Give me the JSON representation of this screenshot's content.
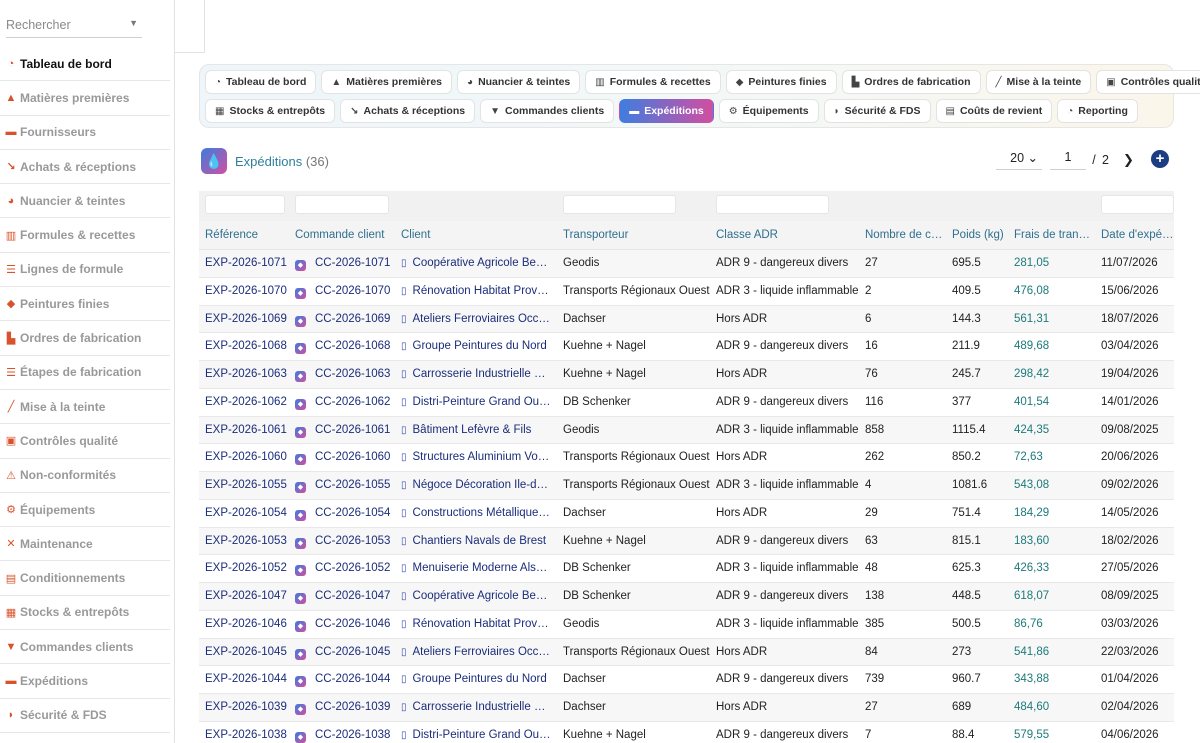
{
  "search": {
    "placeholder": "Rechercher"
  },
  "sidebar": {
    "items": [
      {
        "label": "Tableau de bord",
        "icon": "dashboard-icon",
        "glyph": "◔",
        "active": true
      },
      {
        "label": "Matières premières",
        "icon": "flask-icon",
        "glyph": "▲"
      },
      {
        "label": "Fournisseurs",
        "icon": "truck-icon",
        "glyph": "▬"
      },
      {
        "label": "Achats & réceptions",
        "icon": "dolly-icon",
        "glyph": "↘"
      },
      {
        "label": "Nuancier & teintes",
        "icon": "palette-icon",
        "glyph": "◕"
      },
      {
        "label": "Formules & recettes",
        "icon": "mortar-icon",
        "glyph": "▥"
      },
      {
        "label": "Lignes de formule",
        "icon": "list-icon",
        "glyph": "☰"
      },
      {
        "label": "Peintures finies",
        "icon": "paint-bucket-icon",
        "glyph": "◆"
      },
      {
        "label": "Ordres de fabrication",
        "icon": "industry-icon",
        "glyph": "▙"
      },
      {
        "label": "Étapes de fabrication",
        "icon": "steps-icon",
        "glyph": "☰"
      },
      {
        "label": "Mise à la teinte",
        "icon": "eyedropper-icon",
        "glyph": "╱"
      },
      {
        "label": "Contrôles qualité",
        "icon": "clipboard-check-icon",
        "glyph": "▣"
      },
      {
        "label": "Non-conformités",
        "icon": "warning-icon",
        "glyph": "⚠"
      },
      {
        "label": "Équipements",
        "icon": "cogs-icon",
        "glyph": "⚙"
      },
      {
        "label": "Maintenance",
        "icon": "tools-icon",
        "glyph": "✕"
      },
      {
        "label": "Conditionnements",
        "icon": "box-icon",
        "glyph": "▤"
      },
      {
        "label": "Stocks & entrepôts",
        "icon": "warehouse-icon",
        "glyph": "▦"
      },
      {
        "label": "Commandes clients",
        "icon": "cart-icon",
        "glyph": "▼"
      },
      {
        "label": "Expéditions",
        "icon": "shipping-icon",
        "glyph": "▬"
      },
      {
        "label": "Sécurité & FDS",
        "icon": "shield-icon",
        "glyph": "◗"
      },
      {
        "label": "",
        "icon": "more-icon",
        "glyph": ""
      }
    ]
  },
  "nav": {
    "row1": [
      {
        "label": "Tableau de bord",
        "icon": "dashboard-icon",
        "glyph": "◔"
      },
      {
        "label": "Matières premières",
        "icon": "flask-icon",
        "glyph": "▲"
      },
      {
        "label": "Nuancier & teintes",
        "icon": "palette-icon",
        "glyph": "◕"
      },
      {
        "label": "Formules & recettes",
        "icon": "mortar-icon",
        "glyph": "▥"
      },
      {
        "label": "Peintures finies",
        "icon": "paint-bucket-icon",
        "glyph": "◆"
      },
      {
        "label": "Ordres de fabrication",
        "icon": "industry-icon",
        "glyph": "▙"
      },
      {
        "label": "Mise à la teinte",
        "icon": "eyedropper-icon",
        "glyph": "╱"
      },
      {
        "label": "Contrôles qualité",
        "icon": "clipboard-check-icon",
        "glyph": "▣"
      }
    ],
    "row2": [
      {
        "label": "Stocks & entrepôts",
        "icon": "warehouse-icon",
        "glyph": "▦"
      },
      {
        "label": "Achats & réceptions",
        "icon": "dolly-icon",
        "glyph": "↘"
      },
      {
        "label": "Commandes clients",
        "icon": "cart-icon",
        "glyph": "▼"
      },
      {
        "label": "Expéditions",
        "icon": "shipping-icon",
        "glyph": "▬",
        "active": true
      },
      {
        "label": "Équipements",
        "icon": "cogs-icon",
        "glyph": "⚙"
      },
      {
        "label": "Sécurité & FDS",
        "icon": "shield-icon",
        "glyph": "◗"
      },
      {
        "label": "Coûts de revient",
        "icon": "money-icon",
        "glyph": "▤"
      },
      {
        "label": "Reporting",
        "icon": "pie-chart-icon",
        "glyph": "◔"
      }
    ]
  },
  "header": {
    "title": "Expéditions",
    "count": "(36)",
    "logo_glyph": "💧",
    "per_page": "20 ⌄",
    "page_current": "1",
    "page_sep": "/",
    "page_total": "2",
    "next_glyph": "❯",
    "add_glyph": "+"
  },
  "table": {
    "columns": [
      "Référence",
      "Commande client",
      "Client",
      "Transporteur",
      "Classe ADR",
      "Nombre de c…",
      "Poids (kg)",
      "Frais de tran…",
      "Date d'expé…"
    ],
    "rows": [
      [
        "EXP-2026-1071",
        "CC-2026-1071",
        "Coopérative Agricole Be…",
        "Geodis",
        "ADR 9 - dangereux divers",
        "27",
        "695.5",
        "281,05",
        "11/07/2026"
      ],
      [
        "EXP-2026-1070",
        "CC-2026-1070",
        "Rénovation Habitat Prov…",
        "Transports Régionaux Ouest",
        "ADR 3 - liquide inflammable",
        "2",
        "409.5",
        "476,08",
        "15/06/2026"
      ],
      [
        "EXP-2026-1069",
        "CC-2026-1069",
        "Ateliers Ferroviaires Occ…",
        "Dachser",
        "Hors ADR",
        "6",
        "144.3",
        "561,31",
        "18/07/2026"
      ],
      [
        "EXP-2026-1068",
        "CC-2026-1068",
        "Groupe Peintures du Nord",
        "Kuehne + Nagel",
        "ADR 9 - dangereux divers",
        "16",
        "211.9",
        "489,68",
        "03/04/2026"
      ],
      [
        "EXP-2026-1063",
        "CC-2026-1063",
        "Carrosserie Industrielle …",
        "Kuehne + Nagel",
        "Hors ADR",
        "76",
        "245.7",
        "298,42",
        "19/04/2026"
      ],
      [
        "EXP-2026-1062",
        "CC-2026-1062",
        "Distri-Peinture Grand Ou…",
        "DB Schenker",
        "ADR 9 - dangereux divers",
        "116",
        "377",
        "401,54",
        "14/01/2026"
      ],
      [
        "EXP-2026-1061",
        "CC-2026-1061",
        "Bâtiment Lefèvre & Fils",
        "Geodis",
        "ADR 3 - liquide inflammable",
        "858",
        "1115.4",
        "424,35",
        "09/08/2025"
      ],
      [
        "EXP-2026-1060",
        "CC-2026-1060",
        "Structures Aluminium Vo…",
        "Transports Régionaux Ouest",
        "Hors ADR",
        "262",
        "850.2",
        "72,63",
        "20/06/2026"
      ],
      [
        "EXP-2026-1055",
        "CC-2026-1055",
        "Négoce Décoration Île-d…",
        "Transports Régionaux Ouest",
        "ADR 3 - liquide inflammable",
        "4",
        "1081.6",
        "543,08",
        "09/02/2026"
      ],
      [
        "EXP-2026-1054",
        "CC-2026-1054",
        "Constructions Métallique…",
        "Dachser",
        "Hors ADR",
        "29",
        "751.4",
        "184,29",
        "14/05/2026"
      ],
      [
        "EXP-2026-1053",
        "CC-2026-1053",
        "Chantiers Navals de Brest",
        "Kuehne + Nagel",
        "ADR 9 - dangereux divers",
        "63",
        "815.1",
        "183,60",
        "18/02/2026"
      ],
      [
        "EXP-2026-1052",
        "CC-2026-1052",
        "Menuiserie Moderne Als…",
        "DB Schenker",
        "ADR 3 - liquide inflammable",
        "48",
        "625.3",
        "426,33",
        "27/05/2026"
      ],
      [
        "EXP-2026-1047",
        "CC-2026-1047",
        "Coopérative Agricole Be…",
        "DB Schenker",
        "ADR 9 - dangereux divers",
        "138",
        "448.5",
        "618,07",
        "08/09/2025"
      ],
      [
        "EXP-2026-1046",
        "CC-2026-1046",
        "Rénovation Habitat Prov…",
        "Geodis",
        "ADR 3 - liquide inflammable",
        "385",
        "500.5",
        "86,76",
        "03/03/2026"
      ],
      [
        "EXP-2026-1045",
        "CC-2026-1045",
        "Ateliers Ferroviaires Occ…",
        "Transports Régionaux Ouest",
        "Hors ADR",
        "84",
        "273",
        "541,86",
        "22/03/2026"
      ],
      [
        "EXP-2026-1044",
        "CC-2026-1044",
        "Groupe Peintures du Nord",
        "Dachser",
        "ADR 9 - dangereux divers",
        "739",
        "960.7",
        "343,88",
        "01/04/2026"
      ],
      [
        "EXP-2026-1039",
        "CC-2026-1039",
        "Carrosserie Industrielle …",
        "Dachser",
        "Hors ADR",
        "27",
        "689",
        "484,60",
        "02/04/2026"
      ],
      [
        "EXP-2026-1038",
        "CC-2026-1038",
        "Distri-Peinture Grand Ou…",
        "Kuehne + Nagel",
        "ADR 9 - dangereux divers",
        "7",
        "88.4",
        "579,55",
        "04/06/2026"
      ]
    ]
  },
  "colors": {
    "accent_from": "#3f7de0",
    "accent_to": "#d24ea1",
    "link": "#1b2d7a",
    "money": "#1d7a7a",
    "header_text": "#2f6f8f"
  }
}
